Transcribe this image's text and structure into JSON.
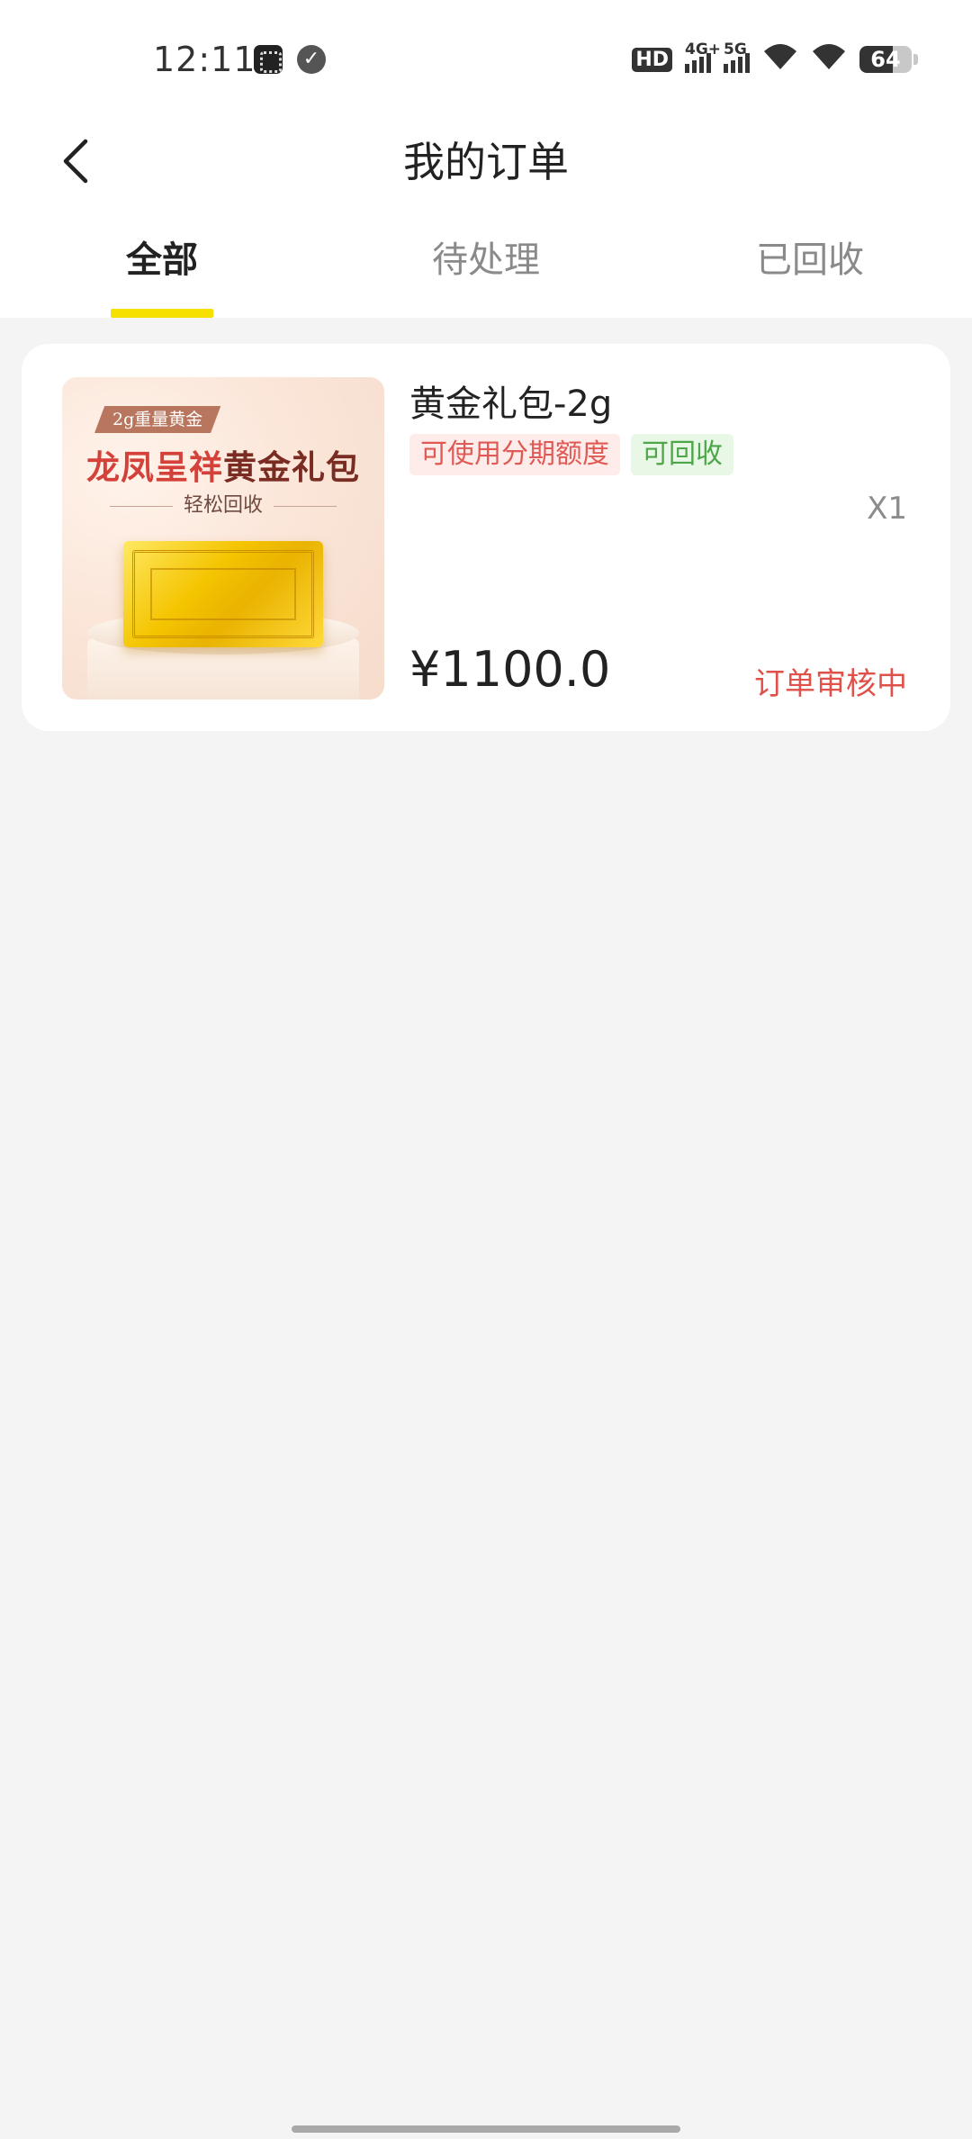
{
  "status_bar": {
    "time": "12:11",
    "app_icons": [
      "puzzle-app-icon",
      "check-circle-icon"
    ],
    "network_labels": [
      "HD",
      "4G+",
      "5G"
    ],
    "battery": "64",
    "battery_level": 0.64
  },
  "header": {
    "title": "我的订单",
    "back_icon": "chevron-left-icon"
  },
  "tabs": [
    {
      "label": "全部",
      "active": true
    },
    {
      "label": "待处理",
      "active": false
    },
    {
      "label": "已回收",
      "active": false
    }
  ],
  "orders": [
    {
      "image": {
        "tag": "2g重量黄金",
        "title_red": "龙凤呈祥",
        "title_dark": "黄金礼包",
        "subtitle": "轻松回收"
      },
      "product_name": "黄金礼包-2g",
      "badges": [
        "可使用分期额度",
        "可回收"
      ],
      "quantity": "X1",
      "price": "¥1100.0",
      "status": "订单审核中"
    }
  ],
  "colors": {
    "accent": "#f6e000",
    "status_red": "#e0514a",
    "badge_green": "#4ea64a",
    "background": "#f4f4f4"
  }
}
